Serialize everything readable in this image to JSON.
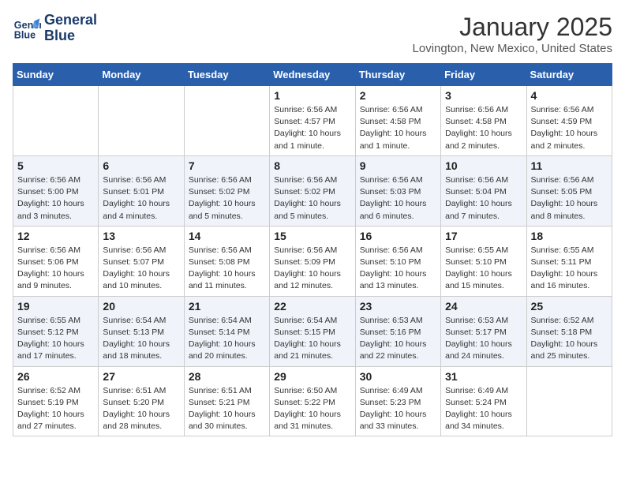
{
  "logo": {
    "line1": "General",
    "line2": "Blue"
  },
  "title": "January 2025",
  "location": "Lovington, New Mexico, United States",
  "weekdays": [
    "Sunday",
    "Monday",
    "Tuesday",
    "Wednesday",
    "Thursday",
    "Friday",
    "Saturday"
  ],
  "weeks": [
    [
      {
        "day": "",
        "info": ""
      },
      {
        "day": "",
        "info": ""
      },
      {
        "day": "",
        "info": ""
      },
      {
        "day": "1",
        "info": "Sunrise: 6:56 AM\nSunset: 4:57 PM\nDaylight: 10 hours\nand 1 minute."
      },
      {
        "day": "2",
        "info": "Sunrise: 6:56 AM\nSunset: 4:58 PM\nDaylight: 10 hours\nand 1 minute."
      },
      {
        "day": "3",
        "info": "Sunrise: 6:56 AM\nSunset: 4:58 PM\nDaylight: 10 hours\nand 2 minutes."
      },
      {
        "day": "4",
        "info": "Sunrise: 6:56 AM\nSunset: 4:59 PM\nDaylight: 10 hours\nand 2 minutes."
      }
    ],
    [
      {
        "day": "5",
        "info": "Sunrise: 6:56 AM\nSunset: 5:00 PM\nDaylight: 10 hours\nand 3 minutes."
      },
      {
        "day": "6",
        "info": "Sunrise: 6:56 AM\nSunset: 5:01 PM\nDaylight: 10 hours\nand 4 minutes."
      },
      {
        "day": "7",
        "info": "Sunrise: 6:56 AM\nSunset: 5:02 PM\nDaylight: 10 hours\nand 5 minutes."
      },
      {
        "day": "8",
        "info": "Sunrise: 6:56 AM\nSunset: 5:02 PM\nDaylight: 10 hours\nand 5 minutes."
      },
      {
        "day": "9",
        "info": "Sunrise: 6:56 AM\nSunset: 5:03 PM\nDaylight: 10 hours\nand 6 minutes."
      },
      {
        "day": "10",
        "info": "Sunrise: 6:56 AM\nSunset: 5:04 PM\nDaylight: 10 hours\nand 7 minutes."
      },
      {
        "day": "11",
        "info": "Sunrise: 6:56 AM\nSunset: 5:05 PM\nDaylight: 10 hours\nand 8 minutes."
      }
    ],
    [
      {
        "day": "12",
        "info": "Sunrise: 6:56 AM\nSunset: 5:06 PM\nDaylight: 10 hours\nand 9 minutes."
      },
      {
        "day": "13",
        "info": "Sunrise: 6:56 AM\nSunset: 5:07 PM\nDaylight: 10 hours\nand 10 minutes."
      },
      {
        "day": "14",
        "info": "Sunrise: 6:56 AM\nSunset: 5:08 PM\nDaylight: 10 hours\nand 11 minutes."
      },
      {
        "day": "15",
        "info": "Sunrise: 6:56 AM\nSunset: 5:09 PM\nDaylight: 10 hours\nand 12 minutes."
      },
      {
        "day": "16",
        "info": "Sunrise: 6:56 AM\nSunset: 5:10 PM\nDaylight: 10 hours\nand 13 minutes."
      },
      {
        "day": "17",
        "info": "Sunrise: 6:55 AM\nSunset: 5:10 PM\nDaylight: 10 hours\nand 15 minutes."
      },
      {
        "day": "18",
        "info": "Sunrise: 6:55 AM\nSunset: 5:11 PM\nDaylight: 10 hours\nand 16 minutes."
      }
    ],
    [
      {
        "day": "19",
        "info": "Sunrise: 6:55 AM\nSunset: 5:12 PM\nDaylight: 10 hours\nand 17 minutes."
      },
      {
        "day": "20",
        "info": "Sunrise: 6:54 AM\nSunset: 5:13 PM\nDaylight: 10 hours\nand 18 minutes."
      },
      {
        "day": "21",
        "info": "Sunrise: 6:54 AM\nSunset: 5:14 PM\nDaylight: 10 hours\nand 20 minutes."
      },
      {
        "day": "22",
        "info": "Sunrise: 6:54 AM\nSunset: 5:15 PM\nDaylight: 10 hours\nand 21 minutes."
      },
      {
        "day": "23",
        "info": "Sunrise: 6:53 AM\nSunset: 5:16 PM\nDaylight: 10 hours\nand 22 minutes."
      },
      {
        "day": "24",
        "info": "Sunrise: 6:53 AM\nSunset: 5:17 PM\nDaylight: 10 hours\nand 24 minutes."
      },
      {
        "day": "25",
        "info": "Sunrise: 6:52 AM\nSunset: 5:18 PM\nDaylight: 10 hours\nand 25 minutes."
      }
    ],
    [
      {
        "day": "26",
        "info": "Sunrise: 6:52 AM\nSunset: 5:19 PM\nDaylight: 10 hours\nand 27 minutes."
      },
      {
        "day": "27",
        "info": "Sunrise: 6:51 AM\nSunset: 5:20 PM\nDaylight: 10 hours\nand 28 minutes."
      },
      {
        "day": "28",
        "info": "Sunrise: 6:51 AM\nSunset: 5:21 PM\nDaylight: 10 hours\nand 30 minutes."
      },
      {
        "day": "29",
        "info": "Sunrise: 6:50 AM\nSunset: 5:22 PM\nDaylight: 10 hours\nand 31 minutes."
      },
      {
        "day": "30",
        "info": "Sunrise: 6:49 AM\nSunset: 5:23 PM\nDaylight: 10 hours\nand 33 minutes."
      },
      {
        "day": "31",
        "info": "Sunrise: 6:49 AM\nSunset: 5:24 PM\nDaylight: 10 hours\nand 34 minutes."
      },
      {
        "day": "",
        "info": ""
      }
    ]
  ]
}
